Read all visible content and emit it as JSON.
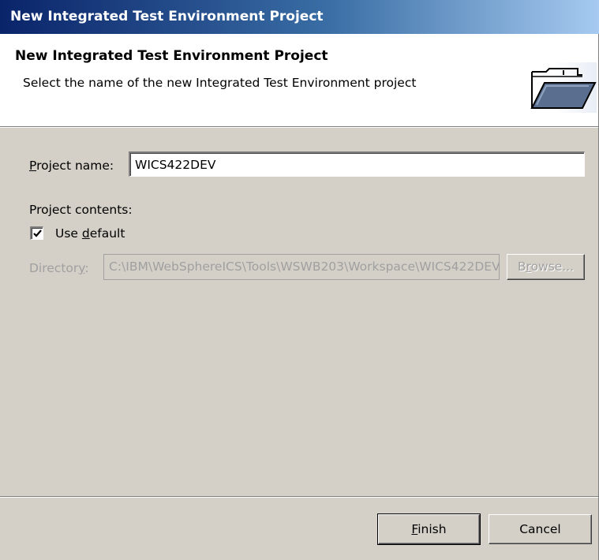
{
  "window": {
    "title": "New Integrated Test Environment Project"
  },
  "banner": {
    "title": "New Integrated Test Environment Project",
    "description": "Select the name of the new Integrated Test Environment project",
    "icon": "folder-icon"
  },
  "form": {
    "project_name_label_mnemonic": "P",
    "project_name_label_rest": "roject name:",
    "project_name_value": "WICS422DEV",
    "project_contents_label": "Project contents:",
    "use_default_label_pre": "Use ",
    "use_default_label_mnemonic": "d",
    "use_default_label_post": "efault",
    "use_default_checked": true,
    "directory_label_pre": "Director",
    "directory_label_mnemonic": "y",
    "directory_label_post": ":",
    "directory_value": "C:\\IBM\\WebSphereICS\\Tools\\WSWB203\\Workspace\\WICS422DEV",
    "browse_label_pre": "B",
    "browse_label_mnemonic": "r",
    "browse_label_post": "owse..."
  },
  "buttons": {
    "finish_mnemonic": "F",
    "finish_rest": "inish",
    "cancel": "Cancel"
  }
}
